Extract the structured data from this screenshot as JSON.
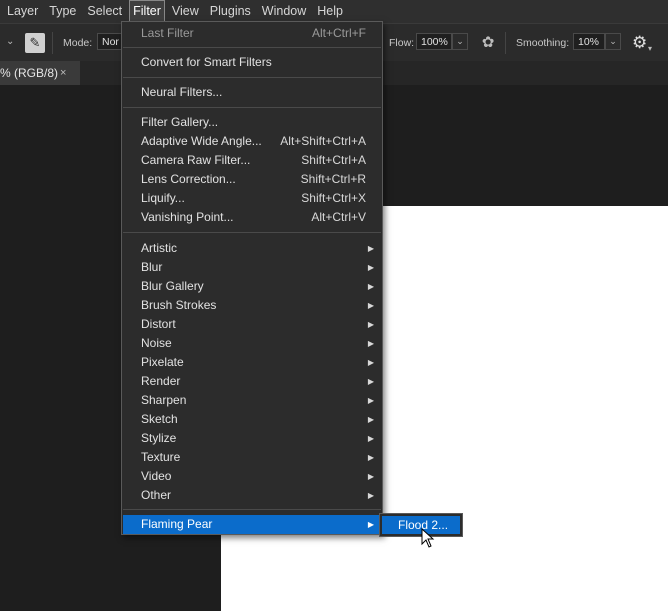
{
  "menubar": {
    "items": [
      "Layer",
      "Type",
      "Select",
      "Filter",
      "View",
      "Plugins",
      "Window",
      "Help"
    ],
    "active": "Filter"
  },
  "options": {
    "mode_label": "Mode:",
    "mode_value": "Nor",
    "flow_label": "Flow:",
    "flow_value": "100%",
    "smoothing_label": "Smoothing:",
    "smoothing_value": "10%",
    "brush_icon": "brush-preset-icon",
    "airbrush_icon": "airbrush-icon",
    "gear_icon": "gear-icon"
  },
  "document_tab": {
    "title": "% (RGB/8)",
    "close": "×"
  },
  "filter_menu": {
    "last_filter": {
      "label": "Last Filter",
      "shortcut": "Alt+Ctrl+F"
    },
    "convert": {
      "label": "Convert for Smart Filters"
    },
    "neural": {
      "label": "Neural Filters..."
    },
    "gallery": {
      "label": "Filter Gallery..."
    },
    "adaptive": {
      "label": "Adaptive Wide Angle...",
      "shortcut": "Alt+Shift+Ctrl+A"
    },
    "camera_raw": {
      "label": "Camera Raw Filter...",
      "shortcut": "Shift+Ctrl+A"
    },
    "lens": {
      "label": "Lens Correction...",
      "shortcut": "Shift+Ctrl+R"
    },
    "liquify": {
      "label": "Liquify...",
      "shortcut": "Shift+Ctrl+X"
    },
    "vanishing": {
      "label": "Vanishing Point...",
      "shortcut": "Alt+Ctrl+V"
    },
    "groups": [
      "Artistic",
      "Blur",
      "Blur Gallery",
      "Brush Strokes",
      "Distort",
      "Noise",
      "Pixelate",
      "Render",
      "Sharpen",
      "Sketch",
      "Stylize",
      "Texture",
      "Video",
      "Other"
    ],
    "plugin": {
      "label": "Flaming Pear"
    }
  },
  "submenu": {
    "item": "Flood 2..."
  },
  "colors": {
    "highlight": "#0b6ccb",
    "menu_bg": "#2c2c2c",
    "canvas": "#ffffff"
  }
}
